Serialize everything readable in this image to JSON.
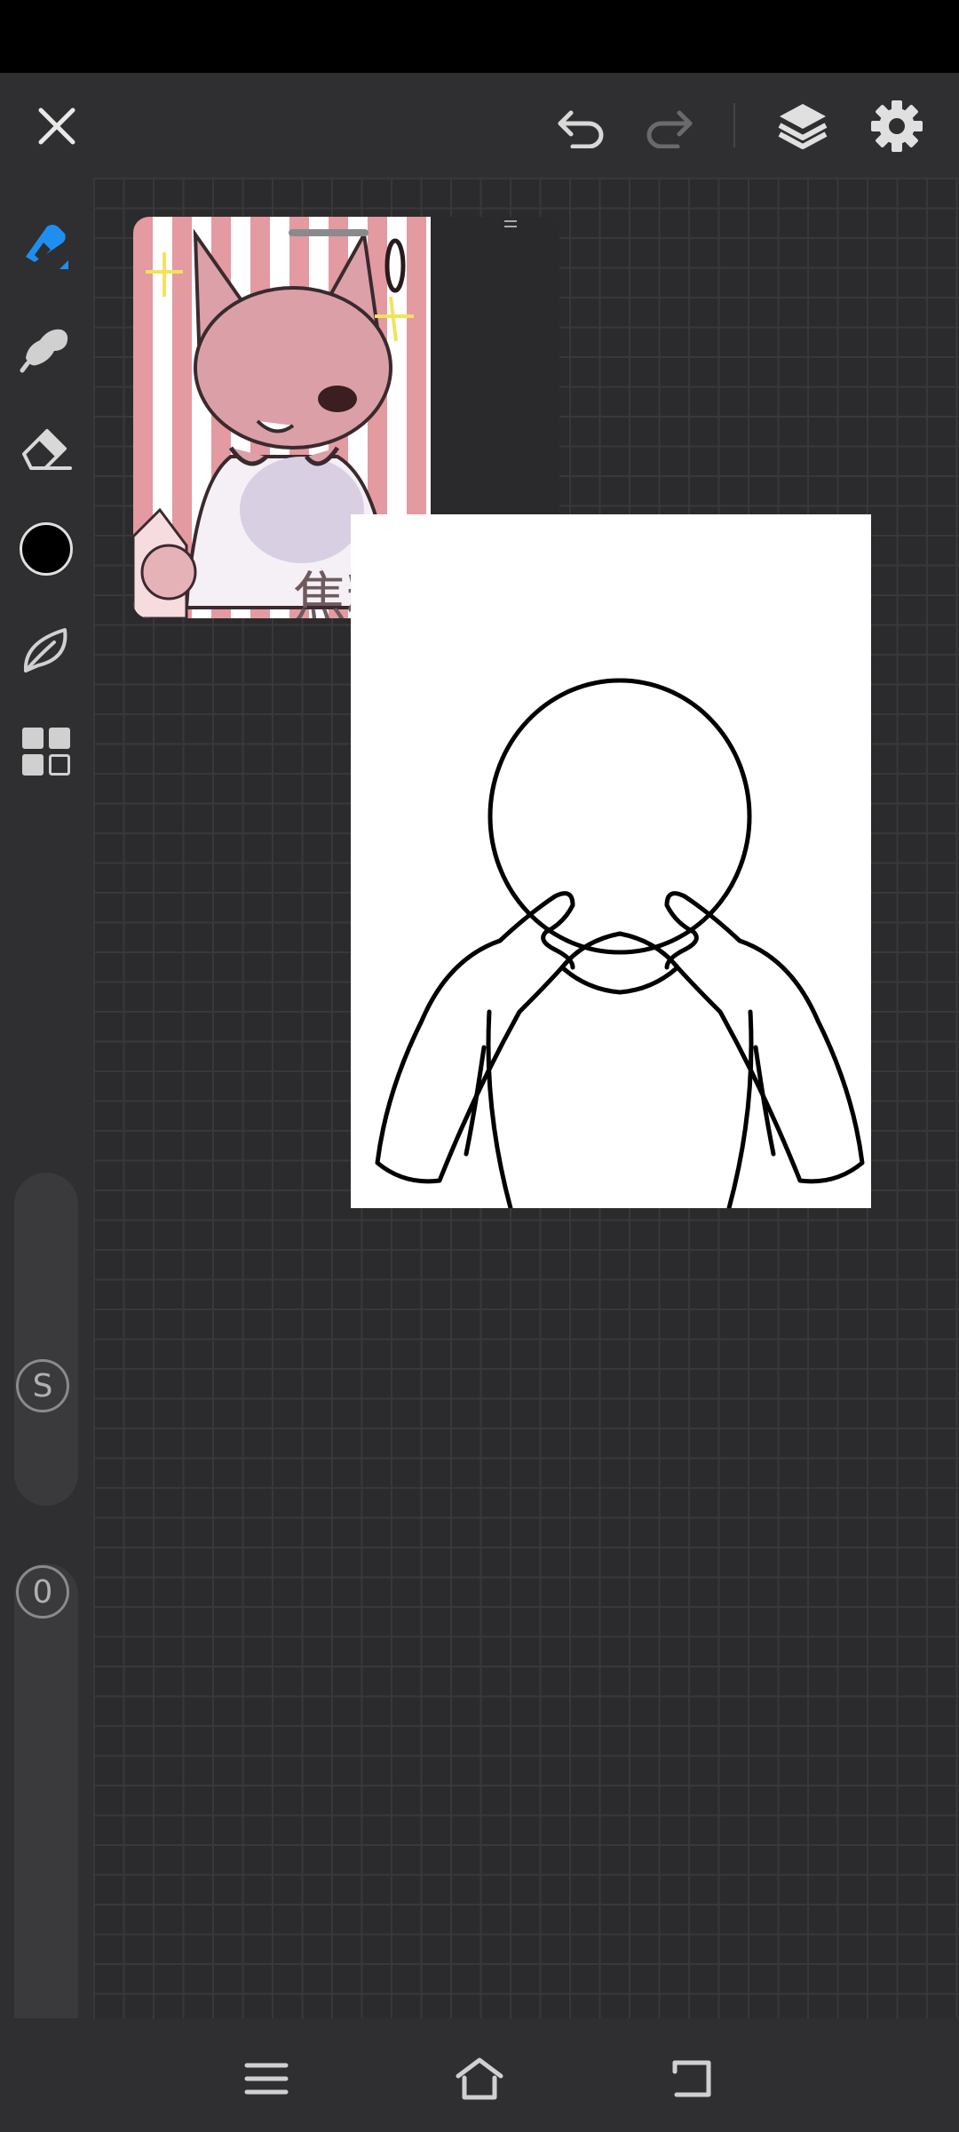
{
  "app": {
    "top_bar": {
      "close": "close-icon",
      "undo": "undo-icon",
      "redo": "redo-icon",
      "layers": "layers-icon",
      "settings": "gear-icon"
    },
    "tools": [
      {
        "id": "pen",
        "icon": "pen-icon",
        "active": true,
        "accent": "#1e8ff0"
      },
      {
        "id": "smudge",
        "icon": "smudge-icon"
      },
      {
        "id": "eraser",
        "icon": "eraser-icon"
      },
      {
        "id": "color",
        "icon": "color-swatch",
        "color": "#000000"
      },
      {
        "id": "brush-library",
        "icon": "leaf-icon"
      },
      {
        "id": "gallery",
        "icon": "grid-icon"
      }
    ],
    "size_slider": {
      "label": "S"
    },
    "opacity_slider": {
      "label": "0"
    },
    "reference_image": {
      "caption": "焦糖"
    },
    "nav": {
      "menu": "menu-icon",
      "home": "home-icon",
      "back": "back-icon"
    }
  }
}
